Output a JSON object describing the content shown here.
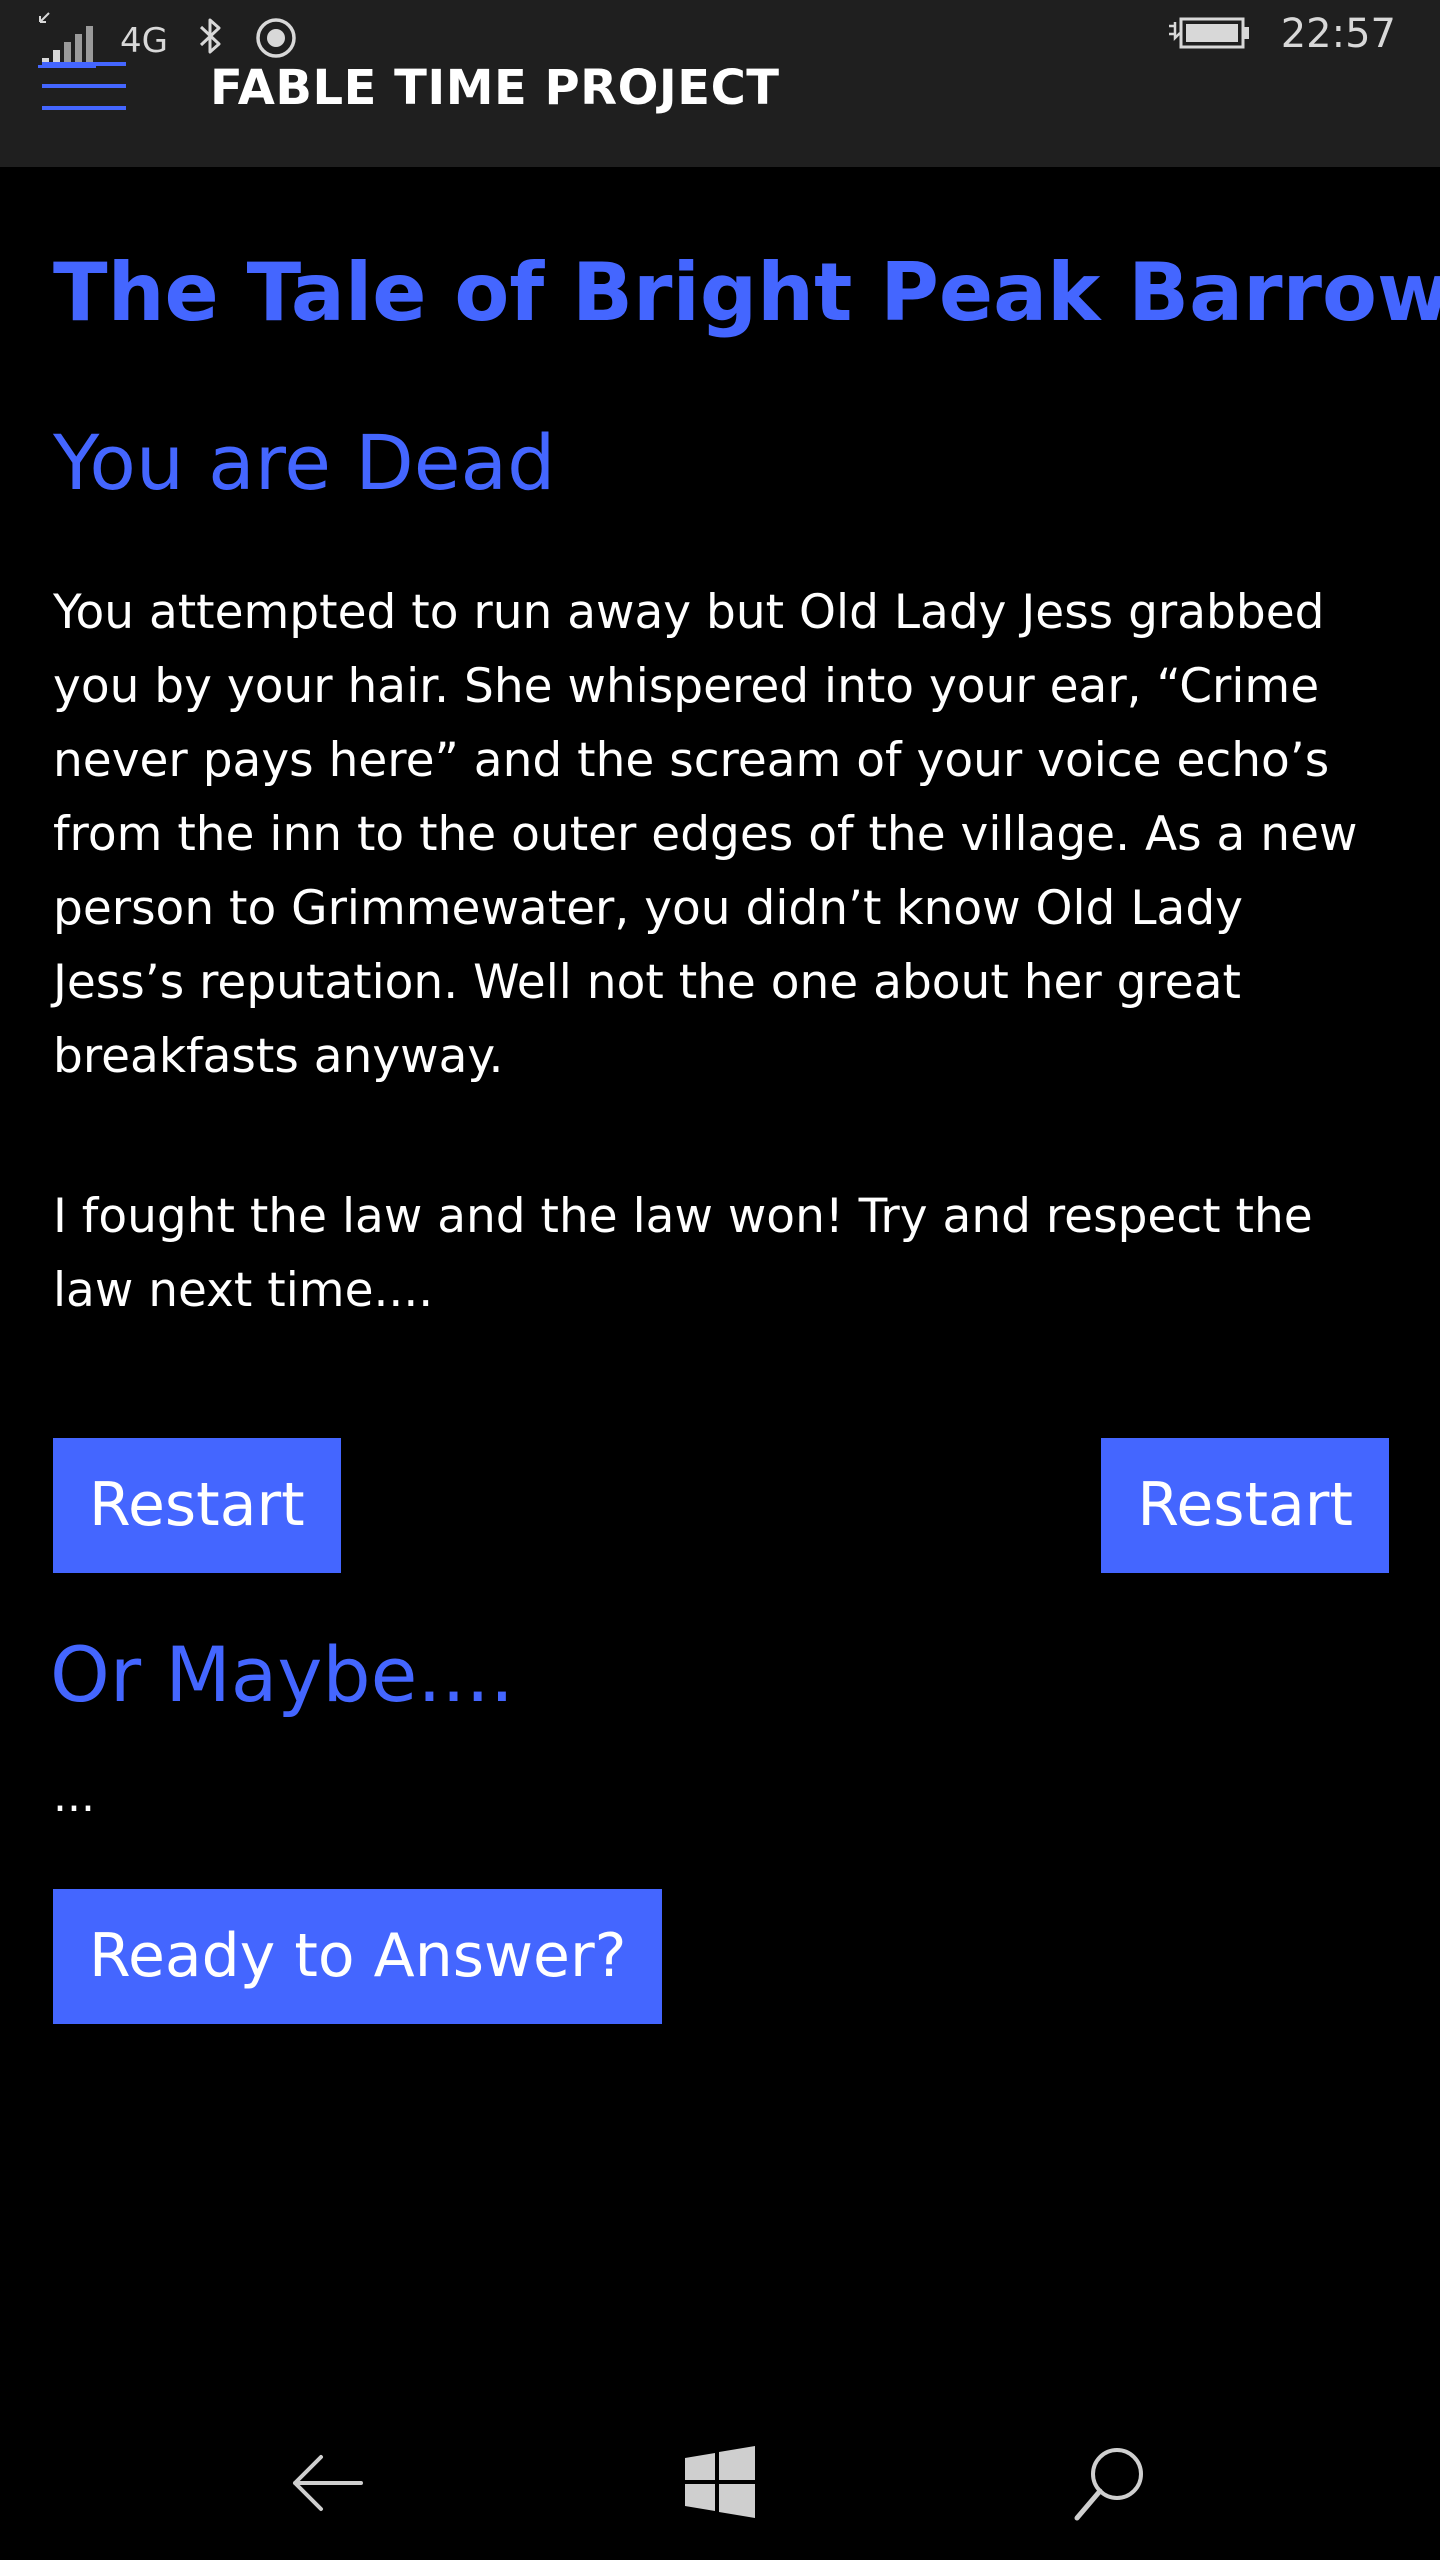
{
  "status_bar": {
    "network": "4G",
    "time": "22:57",
    "icons": [
      "signal-icon",
      "bluetooth-icon",
      "location-icon",
      "battery-icon"
    ]
  },
  "app_header": {
    "title": "FABLE TIME PROJECT",
    "menu_icon": "hamburger-icon"
  },
  "story": {
    "title": "The Tale of Bright Peak Barrow",
    "heading": "You are Dead",
    "paragraphs": [
      "You attempted to run away but Old Lady Jess grabbed you by your hair. She whispered into your ear, “Crime never pays here” and the scream of your voice echo’s from the inn to the outer edges of the village. As a new person to Grimmewater, you didn’t know Old Lady Jess’s reputation. Well not the one about her great breakfasts anyway.",
      "I fought the law and the law won! Try and respect the law next time...."
    ],
    "buttons": {
      "restart_left": "Restart",
      "restart_right": "Restart"
    },
    "alternative": {
      "heading": "Or Maybe....",
      "text": "...",
      "answer_button": "Ready to Answer?"
    }
  },
  "nav_bar": {
    "buttons": [
      "back-arrow-icon",
      "windows-start-icon",
      "search-icon"
    ]
  },
  "colors": {
    "accent": "#4466ff",
    "background": "#000000",
    "header_background": "#1f1f1f",
    "text": "#ffffff"
  }
}
